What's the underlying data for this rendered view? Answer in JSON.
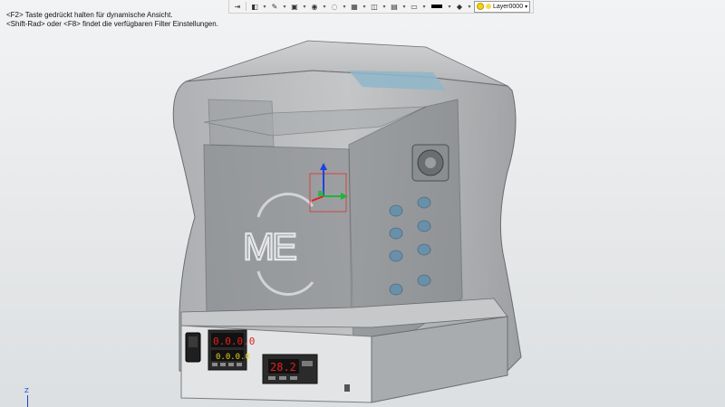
{
  "hints": {
    "line1": "<F2> Taste gedrückt halten für dynamische Ansicht.",
    "line2": "<Shift-Rad> oder <F8> findet die verfügbaren Filter Einstellungen."
  },
  "toolbar": {
    "layer_name": "Layer0000",
    "icons": [
      "exit-icon",
      "view-icon",
      "pen-icon",
      "cube-icon",
      "sphere-icon",
      "filter-icon",
      "grid-icon",
      "render-icon",
      "line-color-icon",
      "layer-icon"
    ]
  },
  "model": {
    "logo_text": "ME",
    "display_left_top": "0.0.0.0",
    "display_left_bottom": "0.0.0.0",
    "display_right": "28.2"
  },
  "triad": {
    "label": "Z"
  },
  "colors": {
    "shell": "#8d9093",
    "display_red": "#e81e1e",
    "axis_x": "#e02020",
    "axis_y": "#1fb53a",
    "axis_z": "#2040e0"
  }
}
